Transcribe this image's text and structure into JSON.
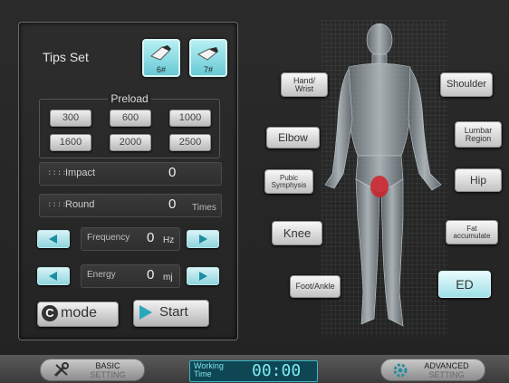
{
  "tips": {
    "label": "Tips Set",
    "items": [
      {
        "label": "6#",
        "selected": true
      },
      {
        "label": "7#",
        "selected": false
      }
    ]
  },
  "preload": {
    "label": "Preload",
    "options": [
      "300",
      "600",
      "1000",
      "1600",
      "2000",
      "2500"
    ]
  },
  "impact": {
    "label": "Impact",
    "value": "0"
  },
  "round": {
    "label": "Round",
    "value": "0",
    "unit": "Times"
  },
  "frequency": {
    "label": "Frequency",
    "value": "0",
    "unit": "Hz"
  },
  "energy": {
    "label": "Energy",
    "value": "0",
    "unit": "mj"
  },
  "mode": {
    "icon_letter": "C",
    "label": "mode"
  },
  "start": {
    "label": "Start"
  },
  "regions": {
    "hand_wrist": {
      "line1": "Hand/",
      "line2": "Wrist"
    },
    "elbow": "Elbow",
    "pubic": {
      "line1": "Pubic",
      "line2": "Symphysis"
    },
    "knee": "Knee",
    "foot_ankle": "Foot/Ankle",
    "shoulder": "Shoulder",
    "lumbar": {
      "line1": "Lumbar",
      "line2": "Region"
    },
    "hip": "Hip",
    "fat": {
      "line1": "Fat",
      "line2": "accumulate"
    },
    "ed": "ED"
  },
  "bottom_bar": {
    "basic": {
      "line1": "BASIC",
      "line2": "SETTING",
      "icon": "wrench-screwdriver-icon"
    },
    "working_time": {
      "label_line1": "Working",
      "label_line2": "Time",
      "value": "00:00"
    },
    "advanced": {
      "line1": "ADVANCED",
      "line2": "SETTING",
      "icon": "gear-icon"
    }
  },
  "colors": {
    "accent_cyan": "#7fe3ee",
    "active_button": "#9ee0e8",
    "target_area": "#d0202a"
  }
}
